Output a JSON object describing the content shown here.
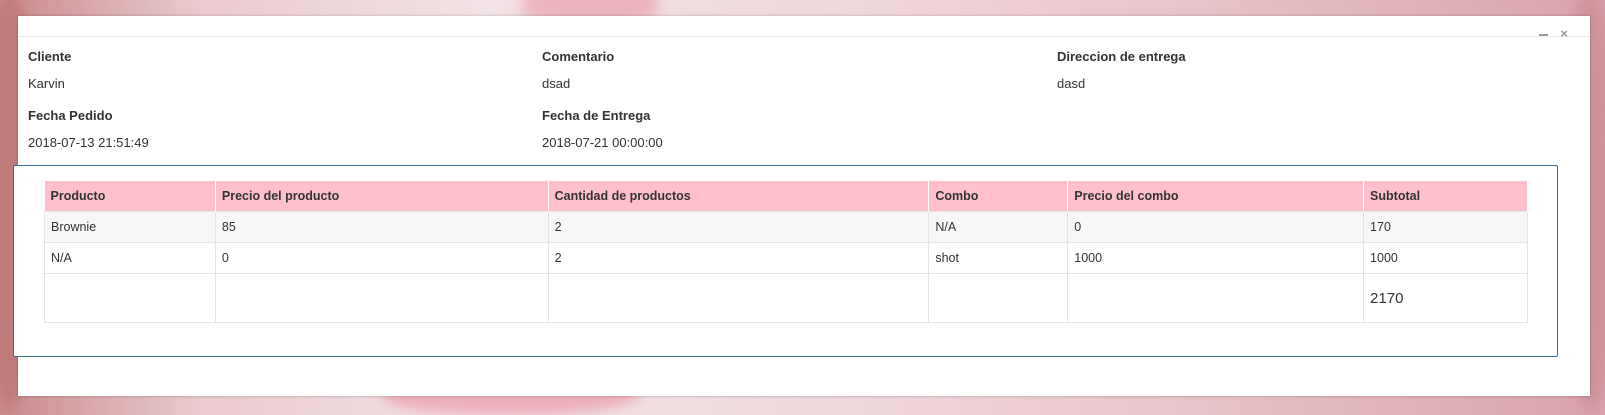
{
  "info": {
    "cliente": {
      "label": "Cliente",
      "value": "Karvin"
    },
    "comentario": {
      "label": "Comentario",
      "value": "dsad"
    },
    "direccion": {
      "label": "Direccion de entrega",
      "value": "dasd"
    },
    "fecha_pedido": {
      "label": "Fecha Pedido",
      "value": "2018-07-13 21:51:49"
    },
    "fecha_entrega": {
      "label": "Fecha de Entrega",
      "value": "2018-07-21 00:00:00"
    }
  },
  "window": {
    "close_icon": "×"
  },
  "table": {
    "headers": [
      "Producto",
      "Precio del producto",
      "Cantidad de productos",
      "Combo",
      "Precio del combo",
      "Subtotal"
    ],
    "rows": [
      [
        "Brownie",
        "85",
        "2",
        "N/A",
        "0",
        "170"
      ],
      [
        "N/A",
        "0",
        "2",
        "shot",
        "1000",
        "1000"
      ]
    ],
    "total": "2170"
  },
  "colors": {
    "header_bg": "#ffc0cb",
    "box_border": "#3b6e96"
  }
}
